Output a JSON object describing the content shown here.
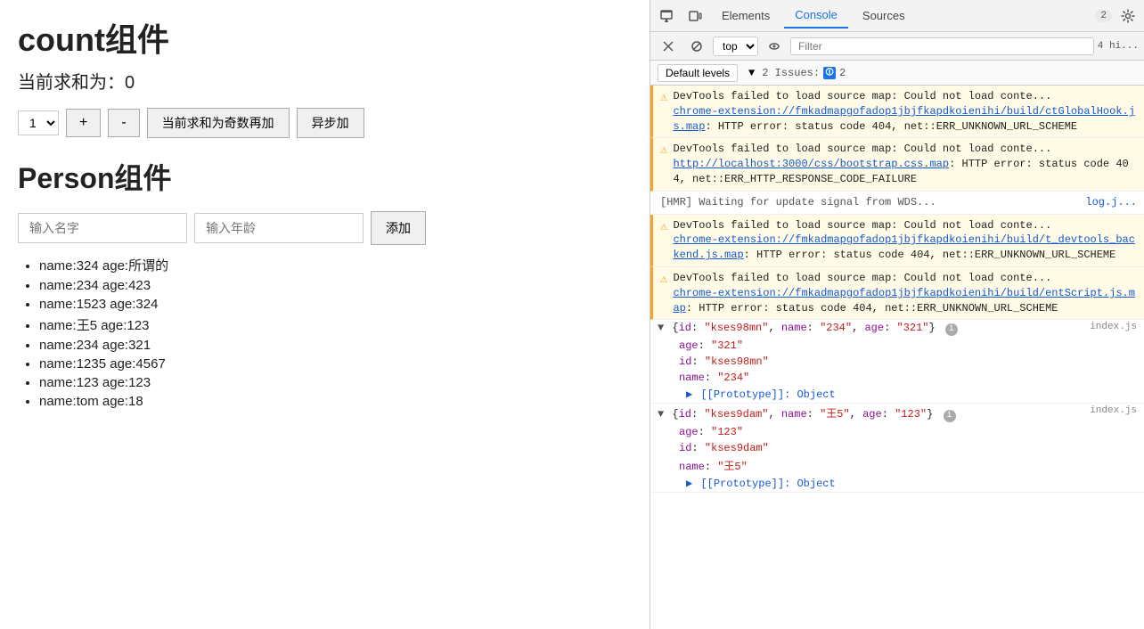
{
  "leftPanel": {
    "countTitle": "count组件",
    "currentSum": "当前求和为：0",
    "selectValue": "1",
    "plusBtn": "+",
    "minusBtn": "-",
    "oddBtn": "当前求和为奇数再加",
    "asyncBtn": "异步加",
    "personTitle": "Person组件",
    "nameInput": {
      "placeholder": "输入名字",
      "value": ""
    },
    "ageInput": {
      "placeholder": "输入年龄",
      "value": ""
    },
    "addBtn": "添加",
    "personList": [
      "name:324  age:所谓的",
      "name:234  age:423",
      "name:1523  age:324",
      "name:王5  age:123",
      "name:234  age:321",
      "name:1235  age:4567",
      "name:123  age:123",
      "name:tom  age:18"
    ]
  },
  "devtools": {
    "tabs": [
      {
        "label": "Elements",
        "active": false
      },
      {
        "label": "Console",
        "active": true
      },
      {
        "label": "Sources",
        "active": false
      }
    ],
    "badgeCount": "2",
    "topbarIcons": {
      "inspect": "⊡",
      "device": "⬜",
      "pause": "⏸",
      "no": "🚫",
      "eye": "👁"
    },
    "topSelect": "top",
    "filterPlaceholder": "Filter",
    "levelText": "4 hi...",
    "defaultLevelsBtn": "Default levels",
    "issuesLabel": "2 Issues:",
    "issuesCount": "2",
    "consoleEntries": [
      {
        "type": "warning",
        "text": "DevTools failed to load source map: Could not load conte...",
        "linkText": "chrome-extension://fmkadmapgofadop1jbjfkapdkoienihi/build/ctGlobalHook.js.map",
        "linkSuffix": ": HTTP error: status code 404, net::ERR_UNKNOWN_URL_SCHEME"
      },
      {
        "type": "warning",
        "text": "DevTools failed to load source map: Could not load conte...",
        "linkText": "http://localhost:3000/css/bootstrap.css.map",
        "linkSuffix": ": HTTP error: status code 404, net::ERR_HTTP_RESPONSE_CODE_FAILURE"
      },
      {
        "type": "info",
        "text": "[HMR] Waiting for update signal from WDS...",
        "linkText": "log.j..."
      },
      {
        "type": "warning",
        "text": "DevTools failed to load source map: Could not load conte...",
        "linkText": "chrome-extension://fmkadmapgofadop1jbjfkapdkoienihi/build/t_devtools_backend.js.map",
        "linkSuffix": ": HTTP error: status code 404, net::ERR_UNKNOWN_URL_SCHEME"
      },
      {
        "type": "warning",
        "text": "DevTools failed to load source map: Could not load conte...",
        "linkText": "chrome-extension://fmkadmapgofadop1jbjfkapdkoienihi/build/entScript.js.map",
        "linkSuffix": ": HTTP error: status code 404, net::ERR_UNKNOWN_URL_SCHEME"
      }
    ],
    "objectEntries": [
      {
        "expanded": true,
        "content": "{id: \"kses98mn\", name: \"234\", age: \"321\"}",
        "filename": "index.js",
        "fields": [
          {
            "key": "age",
            "value": "\"321\""
          },
          {
            "key": "id",
            "value": "\"kses98mn\""
          },
          {
            "key": "name",
            "value": "\"234\""
          }
        ],
        "prototype": "[[Prototype]]: Object"
      },
      {
        "expanded": true,
        "content": "{id: \"kses9dam\", name: \"王5\", age: \"123\"}",
        "filename": "index.js",
        "fields": [
          {
            "key": "age",
            "value": "\"123\""
          },
          {
            "key": "id",
            "value": "\"kses9dam\""
          },
          {
            "key": "name",
            "value": "\"王5\""
          }
        ],
        "prototype": "[[Prototype]]: Object"
      }
    ]
  }
}
